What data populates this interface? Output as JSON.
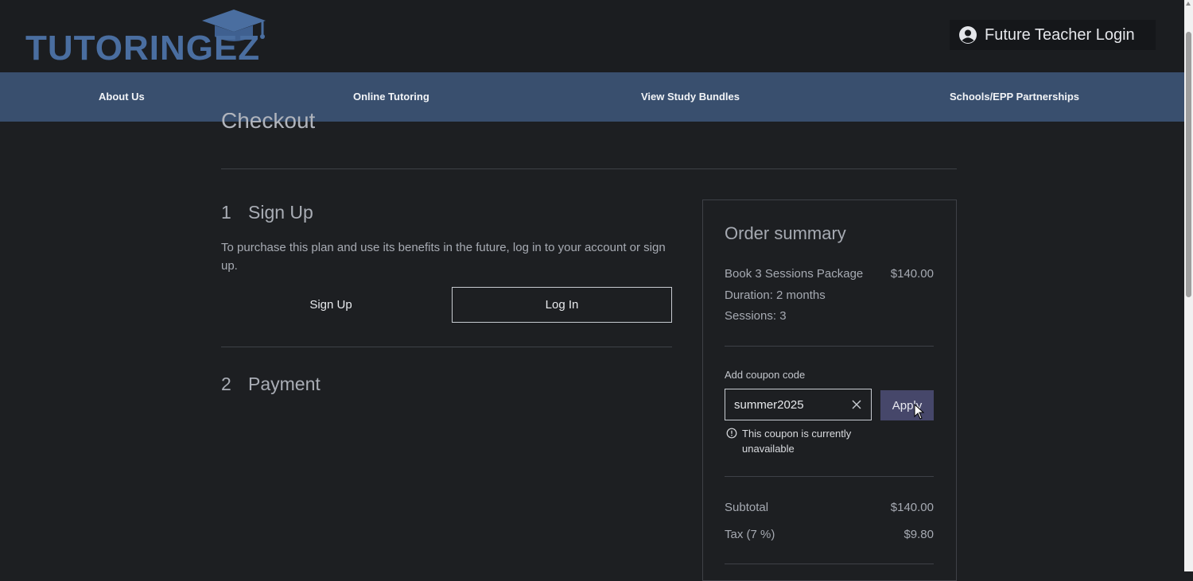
{
  "header": {
    "logo_text": "TUTORINGEZ",
    "login_label": "Future Teacher Login"
  },
  "nav": {
    "items": [
      "About Us",
      "Online Tutoring",
      "View Study Bundles",
      "Schools/EPP Partnerships"
    ]
  },
  "checkout": {
    "title": "Checkout",
    "step1": {
      "number": "1",
      "title": "Sign Up",
      "description": "To purchase this plan and use its benefits in the future, log in to your account or sign up.",
      "signup_label": "Sign Up",
      "login_label": "Log In"
    },
    "step2": {
      "number": "2",
      "title": "Payment"
    }
  },
  "order_summary": {
    "title": "Order summary",
    "item_name": "Book 3 Sessions Package",
    "item_price": "$140.00",
    "duration": "Duration: 2 months",
    "sessions": "Sessions: 3",
    "coupon_label": "Add coupon code",
    "coupon_value": "summer2025",
    "apply_label": "Apply",
    "coupon_error": "This coupon is currently unavailable",
    "subtotal_label": "Subtotal",
    "subtotal_value": "$140.00",
    "tax_label": "Tax (7 %)",
    "tax_value": "$9.80"
  },
  "colors": {
    "background": "#1d1f22",
    "navbar": "#394f6e",
    "logo": "#4a6ea0",
    "apply_button": "#46476a"
  }
}
